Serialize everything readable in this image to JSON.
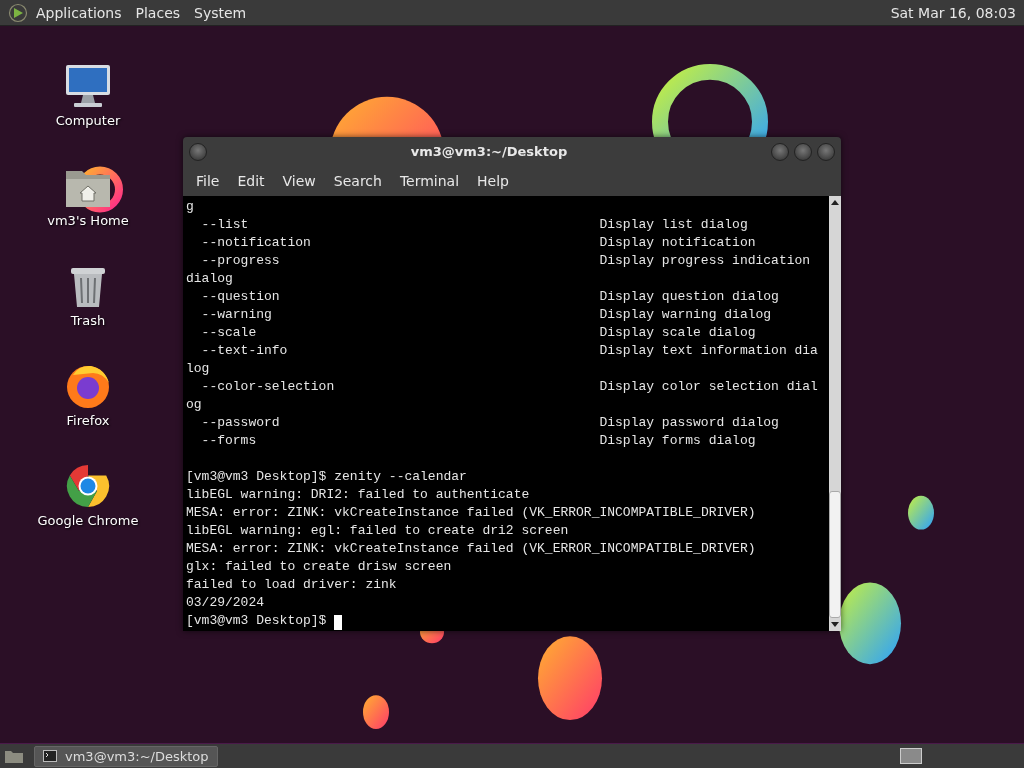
{
  "top_panel": {
    "menus": [
      "Applications",
      "Places",
      "System"
    ],
    "clock": "Sat Mar 16, 08:03"
  },
  "desktop_icons": [
    {
      "label": "Computer",
      "kind": "computer"
    },
    {
      "label": "vm3's Home",
      "kind": "home"
    },
    {
      "label": "Trash",
      "kind": "trash"
    },
    {
      "label": "Firefox",
      "kind": "firefox"
    },
    {
      "label": "Google Chrome",
      "kind": "chrome"
    }
  ],
  "window": {
    "title": "vm3@vm3:~/Desktop",
    "menu": [
      "File",
      "Edit",
      "View",
      "Search",
      "Terminal",
      "Help"
    ],
    "terminal": {
      "lines": [
        {
          "kind": "text",
          "text": "g"
        },
        {
          "kind": "option",
          "option": "--list",
          "description": "Display list dialog"
        },
        {
          "kind": "option",
          "option": "--notification",
          "description": "Display notification"
        },
        {
          "kind": "option",
          "option": "--progress",
          "description": "Display progress indication"
        },
        {
          "kind": "text",
          "text": "dialog"
        },
        {
          "kind": "option",
          "option": "--question",
          "description": "Display question dialog"
        },
        {
          "kind": "option",
          "option": "--warning",
          "description": "Display warning dialog"
        },
        {
          "kind": "option",
          "option": "--scale",
          "description": "Display scale dialog"
        },
        {
          "kind": "option",
          "option": "--text-info",
          "description": "Display text information dia"
        },
        {
          "kind": "text",
          "text": "log"
        },
        {
          "kind": "option",
          "option": "--color-selection",
          "description": "Display color selection dial"
        },
        {
          "kind": "text",
          "text": "og"
        },
        {
          "kind": "option",
          "option": "--password",
          "description": "Display password dialog"
        },
        {
          "kind": "option",
          "option": "--forms",
          "description": "Display forms dialog"
        },
        {
          "kind": "text",
          "text": "[vm3@vm3 Desktop]$ zenity --calendar",
          "blank_before": true
        },
        {
          "kind": "text",
          "text": "libEGL warning: DRI2: failed to authenticate"
        },
        {
          "kind": "text",
          "text": "MESA: error: ZINK: vkCreateInstance failed (VK_ERROR_INCOMPATIBLE_DRIVER)"
        },
        {
          "kind": "text",
          "text": "libEGL warning: egl: failed to create dri2 screen"
        },
        {
          "kind": "text",
          "text": "MESA: error: ZINK: vkCreateInstance failed (VK_ERROR_INCOMPATIBLE_DRIVER)"
        },
        {
          "kind": "text",
          "text": "glx: failed to create drisw screen"
        },
        {
          "kind": "text",
          "text": "failed to load driver: zink"
        },
        {
          "kind": "text",
          "text": "03/29/2024"
        },
        {
          "kind": "prompt",
          "text": "[vm3@vm3 Desktop]$",
          "cursor": true
        }
      ]
    }
  },
  "taskbar": {
    "tasks": [
      {
        "label": "vm3@vm3:~/Desktop",
        "selected": true
      }
    ]
  }
}
